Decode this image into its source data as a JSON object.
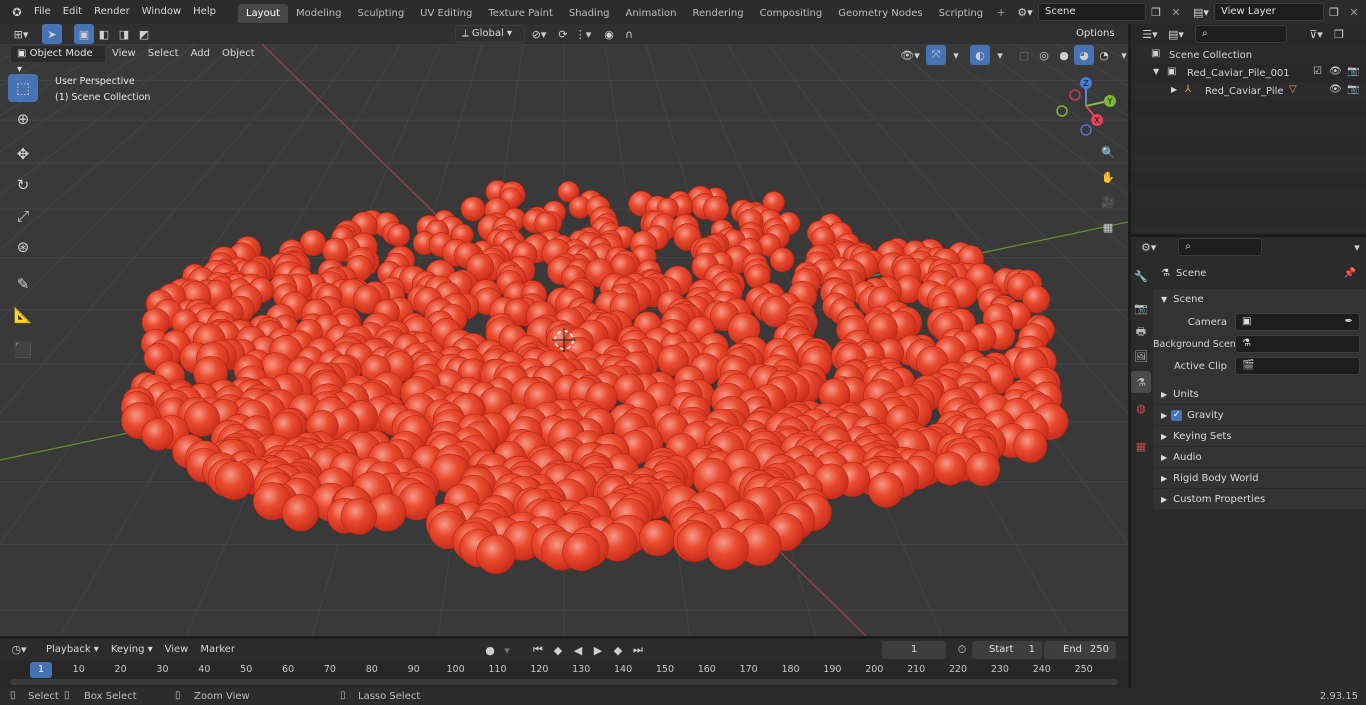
{
  "menus": [
    "File",
    "Edit",
    "Render",
    "Window",
    "Help"
  ],
  "workspaces": [
    "Layout",
    "Modeling",
    "Sculpting",
    "UV Editing",
    "Texture Paint",
    "Shading",
    "Animation",
    "Rendering",
    "Compositing",
    "Geometry Nodes",
    "Scripting"
  ],
  "active_workspace": "Layout",
  "scene_field": "Scene",
  "view_layer_field": "View Layer",
  "viewport": {
    "mode": "Object Mode",
    "header_menus": [
      "View",
      "Select",
      "Add",
      "Object"
    ],
    "transform_orientation": "Global",
    "options_label": "Options",
    "overlay_line1": "User Perspective",
    "overlay_line2": "(1) Scene Collection",
    "gizmo_axes": {
      "x": "X",
      "y": "Y",
      "z": "Z"
    }
  },
  "outliner": {
    "root": "Scene Collection",
    "collection": "Red_Caviar_Pile_001",
    "object": "Red_Caviar_Pile"
  },
  "properties": {
    "header": "Scene",
    "panel": "Scene",
    "camera_label": "Camera",
    "background_label": "Background Scene",
    "clip_label": "Active Clip",
    "sections": [
      "Units",
      "Gravity",
      "Keying Sets",
      "Audio",
      "Rigid Body World",
      "Custom Properties"
    ]
  },
  "timeline": {
    "menus": [
      "Playback",
      "Keying",
      "View",
      "Marker"
    ],
    "current_frame": "1",
    "start_label": "Start",
    "start_value": "1",
    "end_label": "End",
    "end_value": "250",
    "ticks": [
      "1",
      "10",
      "20",
      "30",
      "40",
      "50",
      "60",
      "70",
      "80",
      "90",
      "100",
      "110",
      "120",
      "130",
      "140",
      "150",
      "160",
      "170",
      "180",
      "190",
      "200",
      "210",
      "220",
      "230",
      "240",
      "250"
    ]
  },
  "status": {
    "select": "Select",
    "box_select": "Box Select",
    "zoom": "Zoom View",
    "lasso": "Lasso Select",
    "version": "2.93.15"
  },
  "colors": {
    "accent": "#4772b3",
    "caviar": "#e84a2e",
    "x_axis": "#b0414a",
    "y_axis": "#6a9a2a"
  }
}
